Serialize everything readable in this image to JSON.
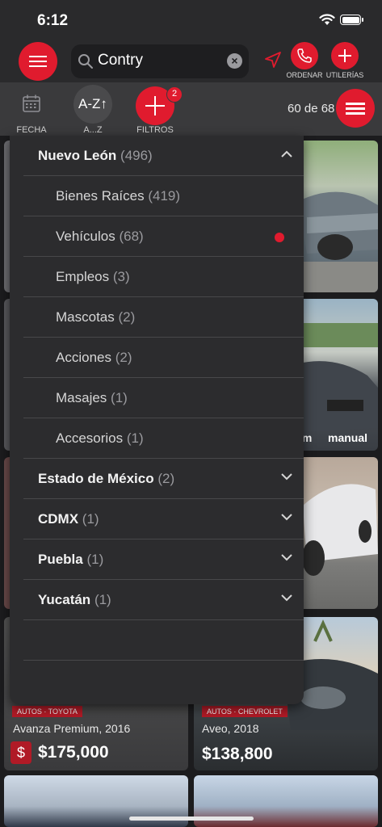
{
  "status": {
    "time": "6:12"
  },
  "header": {
    "search_value": "Contry",
    "actions": [
      {
        "label": "ORDENAR",
        "icon": "phone-icon"
      },
      {
        "label": "UTILERÍAS",
        "icon": "plus-icon"
      }
    ]
  },
  "toolbar": {
    "fecha_label": "FECHA",
    "sort_icon_text": "A-Z↑",
    "sort_label": "A...Z",
    "filters_label": "FILTROS",
    "filters_badge": "2",
    "count": "60 de 68"
  },
  "listings": [
    {
      "desc": "Avanza Premium, 2016",
      "price": "$175,000",
      "tag": "AUTOS · TOYOTA"
    },
    {
      "desc": "Aveo, 2018",
      "price": "$138,800",
      "tag": "AUTOS · CHEVROLET"
    }
  ],
  "partial_text": {
    "domain_fragment": ".m",
    "manual": "manual"
  },
  "dropdown": {
    "expanded": {
      "name": "Nuevo León",
      "count": "(496)"
    },
    "subitems": [
      {
        "name": "Bienes Raíces",
        "count": "(419)"
      },
      {
        "name": "Vehículos",
        "count": "(68)",
        "selected": true
      },
      {
        "name": "Empleos",
        "count": "(3)"
      },
      {
        "name": "Mascotas",
        "count": "(2)"
      },
      {
        "name": "Acciones",
        "count": "(2)"
      },
      {
        "name": "Masajes",
        "count": "(1)"
      },
      {
        "name": "Accesorios",
        "count": "(1)"
      }
    ],
    "regions": [
      {
        "name": "Estado de México",
        "count": "(2)"
      },
      {
        "name": "CDMX",
        "count": "(1)"
      },
      {
        "name": "Puebla",
        "count": "(1)"
      },
      {
        "name": "Yucatán",
        "count": "(1)"
      }
    ]
  },
  "colors": {
    "accent": "#e01b2e",
    "panel": "#2c2c2e",
    "background": "#1c1c1e"
  }
}
